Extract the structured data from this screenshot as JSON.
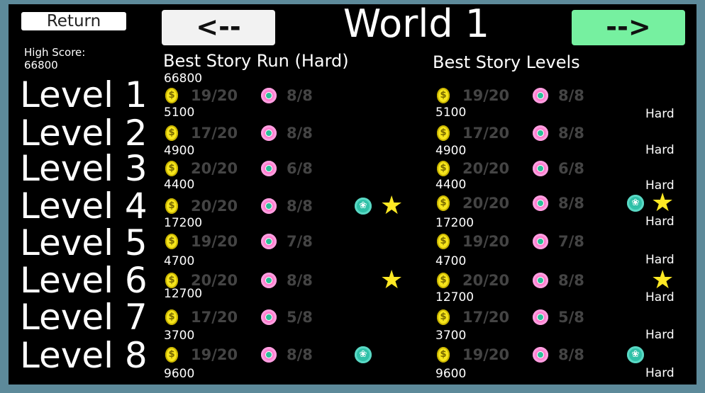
{
  "header": {
    "return_label": "Return",
    "prev_label": "<--",
    "next_label": "-->",
    "world_title": "World 1"
  },
  "high_score": {
    "label": "High Score:",
    "value": "66800"
  },
  "levels": [
    "Level 1",
    "Level 2",
    "Level 3",
    "Level 4",
    "Level 5",
    "Level 6",
    "Level 7",
    "Level 8"
  ],
  "story_run": {
    "title": "Best Story Run (Hard)",
    "total_score": "66800",
    "rows": [
      {
        "coins": "19/20",
        "gems": "8/8",
        "score": "5100",
        "special": false,
        "star": false
      },
      {
        "coins": "17/20",
        "gems": "8/8",
        "score": "4900",
        "special": false,
        "star": false
      },
      {
        "coins": "20/20",
        "gems": "6/8",
        "score": "4400",
        "special": false,
        "star": false
      },
      {
        "coins": "20/20",
        "gems": "8/8",
        "score": "17200",
        "special": true,
        "star": true
      },
      {
        "coins": "19/20",
        "gems": "7/8",
        "score": "4700",
        "special": false,
        "star": false
      },
      {
        "coins": "20/20",
        "gems": "8/8",
        "score": "12700",
        "special": false,
        "star": true
      },
      {
        "coins": "17/20",
        "gems": "5/8",
        "score": "3700",
        "special": false,
        "star": false
      },
      {
        "coins": "19/20",
        "gems": "8/8",
        "score": "9600",
        "special": true,
        "star": false
      }
    ]
  },
  "story_levels": {
    "title": "Best Story Levels",
    "rows": [
      {
        "coins": "19/20",
        "gems": "8/8",
        "score": "5100",
        "difficulty": "Hard",
        "special": false,
        "star": false
      },
      {
        "coins": "17/20",
        "gems": "8/8",
        "score": "4900",
        "difficulty": "Hard",
        "special": false,
        "star": false
      },
      {
        "coins": "20/20",
        "gems": "6/8",
        "score": "4400",
        "difficulty": "Hard",
        "special": false,
        "star": false
      },
      {
        "coins": "20/20",
        "gems": "8/8",
        "score": "17200",
        "difficulty": "Hard",
        "special": true,
        "star": true
      },
      {
        "coins": "19/20",
        "gems": "7/8",
        "score": "4700",
        "difficulty": "Hard",
        "special": false,
        "star": false
      },
      {
        "coins": "20/20",
        "gems": "8/8",
        "score": "12700",
        "difficulty": "Hard",
        "special": false,
        "star": true
      },
      {
        "coins": "17/20",
        "gems": "5/8",
        "score": "3700",
        "difficulty": "Hard",
        "special": false,
        "star": false
      },
      {
        "coins": "19/20",
        "gems": "8/8",
        "score": "9600",
        "difficulty": "Hard",
        "special": true,
        "star": false
      }
    ]
  },
  "icons": {
    "coin": "coin-icon",
    "gem": "gem-icon",
    "special": "special-gem-icon",
    "star": "star-icon"
  },
  "colors": {
    "frame": "#5d8a9a",
    "background": "#000000",
    "next_button": "#76f0a0",
    "coin": "#f6e51c",
    "gem": "#ff7fd0",
    "star": "#ffe924",
    "count_text": "#444444"
  }
}
